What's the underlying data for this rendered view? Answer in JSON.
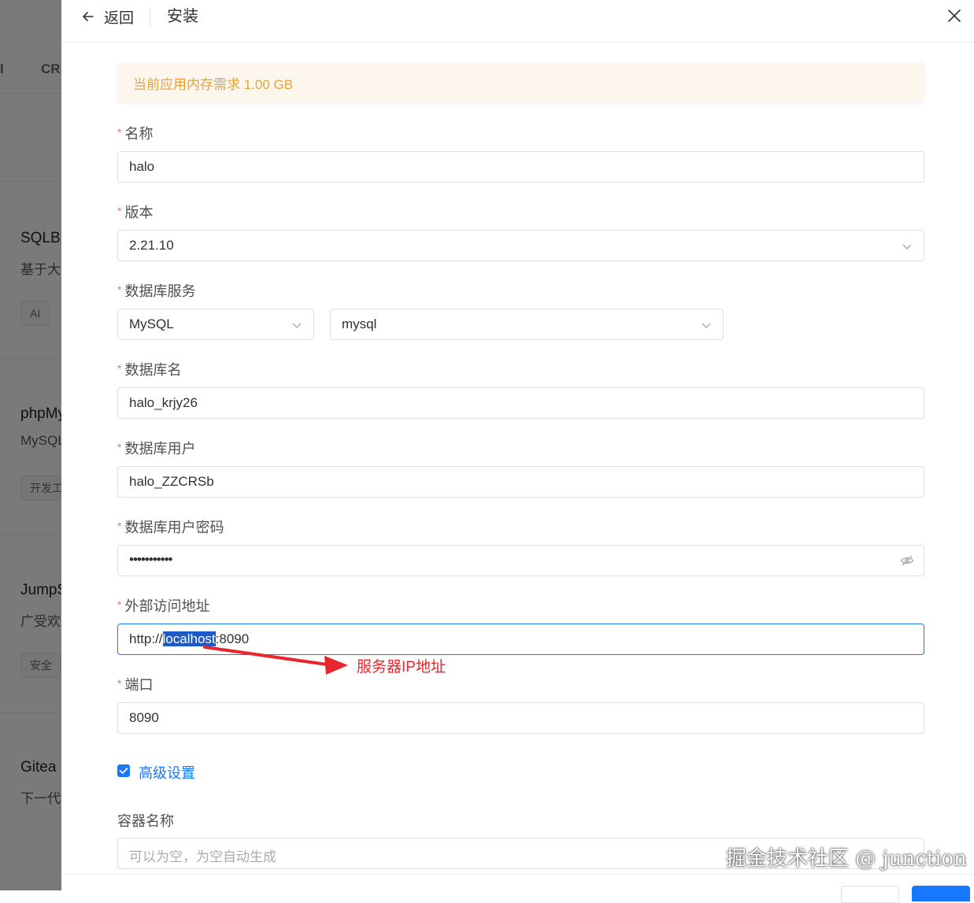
{
  "background": {
    "tabs": [
      "I",
      "CR"
    ],
    "cards": [
      {
        "title": "SQLB",
        "desc": "基于大",
        "tag": "AI"
      },
      {
        "title": "phpMy",
        "desc": "MySQL",
        "tag": "开发工"
      },
      {
        "title": "JumpS",
        "desc": "广受欢",
        "tag": "安全"
      },
      {
        "title": "Gitea",
        "desc": "下一代",
        "tag": ""
      }
    ]
  },
  "header": {
    "back_label": "返回",
    "title": "安装"
  },
  "alert": {
    "text": "当前应用内存需求 1.00 GB"
  },
  "form": {
    "required_mark": "*",
    "name": {
      "label": "名称",
      "value": "halo"
    },
    "version": {
      "label": "版本",
      "value": "2.21.10"
    },
    "db_service": {
      "label": "数据库服务",
      "type_value": "MySQL",
      "instance_value": "mysql"
    },
    "db_name": {
      "label": "数据库名",
      "value": "halo_krjy26"
    },
    "db_user": {
      "label": "数据库用户",
      "value": "halo_ZZCRSb"
    },
    "db_password": {
      "label": "数据库用户密码",
      "value": "•••••••••••"
    },
    "external_url": {
      "label": "外部访问地址",
      "value_prefix": "http://",
      "value_selected": "localhost",
      "value_suffix": ":8090"
    },
    "port": {
      "label": "端口",
      "value": "8090"
    },
    "advanced": {
      "label": "高级设置",
      "checked": true
    },
    "container_name": {
      "label": "容器名称",
      "placeholder": "可以为空，为空自动生成"
    }
  },
  "annotation": {
    "text": "服务器IP地址",
    "color": "#e8262d"
  },
  "watermark": "掘金技术社区 @ junction",
  "colors": {
    "primary": "#1677ff",
    "required": "#f56c6c",
    "warning": "#e6a23c"
  }
}
